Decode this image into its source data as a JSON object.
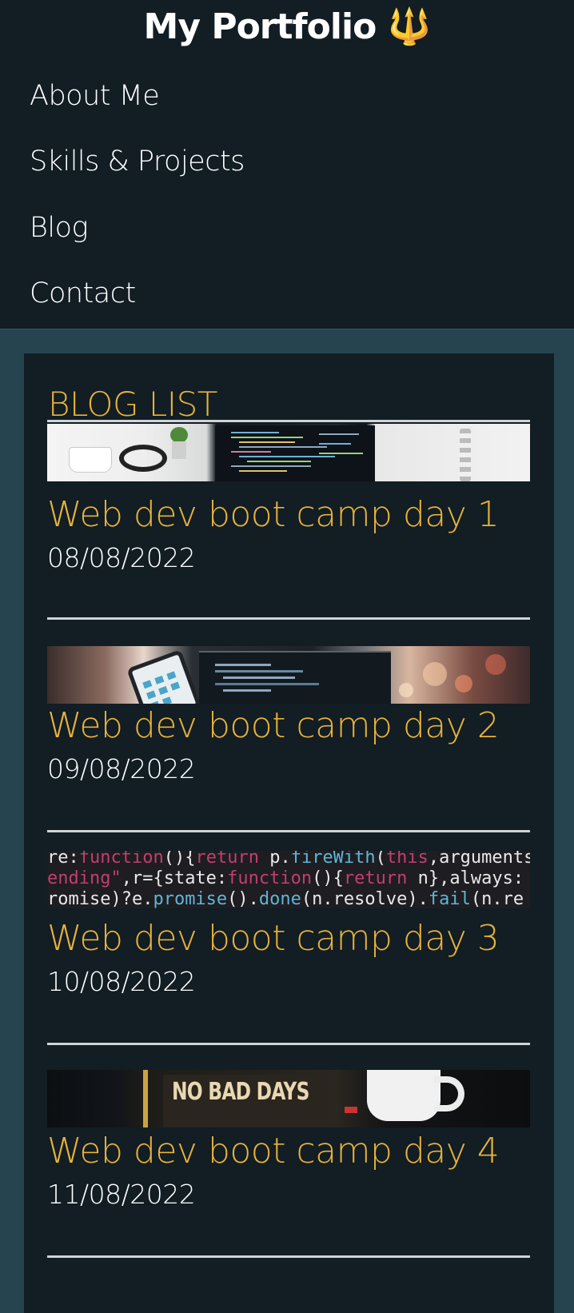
{
  "header": {
    "title": "My Portfolio",
    "title_icon": "🔱",
    "nav": [
      {
        "label": "About Me"
      },
      {
        "label": "Skills & Projects"
      },
      {
        "label": "Blog"
      },
      {
        "label": "Contact"
      }
    ]
  },
  "blog": {
    "heading": "BLOG LIST",
    "posts": [
      {
        "title": "Web dev boot camp day 1",
        "date": "08/08/2022",
        "image": "desk-laptop-image"
      },
      {
        "title": "Web dev boot camp day 2",
        "date": "09/08/2022",
        "image": "phone-laptop-image"
      },
      {
        "title": "Web dev boot camp day 3",
        "date": "10/08/2022",
        "image": "code-image"
      },
      {
        "title": "Web dev boot camp day 4",
        "date": "11/08/2022",
        "image": "no-bad-days-image"
      }
    ],
    "code_image_lines": [
      "re:function(){return p.fireWith(this,arguments",
      "ending\",r={state:function(){return n},always:",
      "romise)?e.promise().done(n.resolve).fail(n.re"
    ],
    "sign_text": "NO BAD DAYS"
  },
  "colors": {
    "page_bg": "#25444f",
    "panel_bg": "#121d24",
    "accent": "#e8b33a",
    "text": "#ffffff"
  }
}
